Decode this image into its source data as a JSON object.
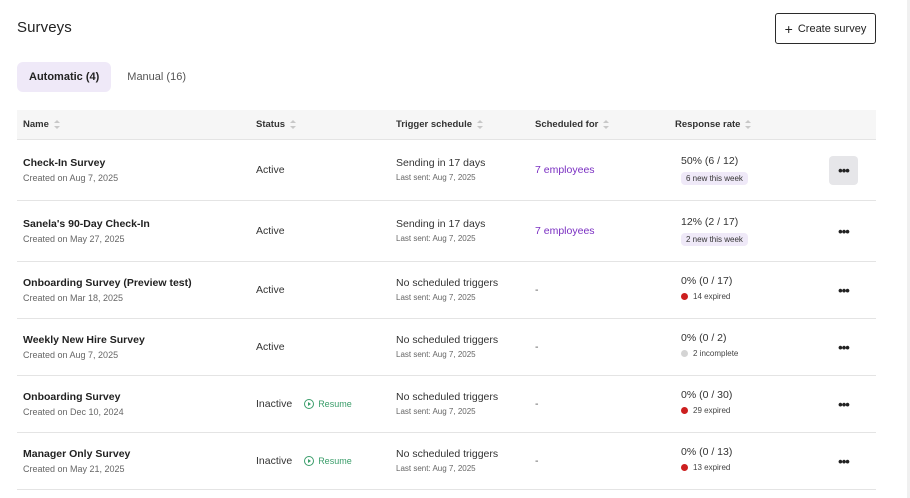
{
  "page": {
    "title": "Surveys",
    "create_label": "Create survey"
  },
  "tabs": [
    {
      "label": "Automatic (4)",
      "active": true
    },
    {
      "label": "Manual (16)",
      "active": false
    }
  ],
  "columns": [
    "Name",
    "Status",
    "Trigger schedule",
    "Scheduled for",
    "Response rate"
  ],
  "colors": {
    "accent": "#7a2fc2",
    "pill_bg": "#efe9f8",
    "expired": "#cc1f1f",
    "incomplete": "#d4d4d4",
    "resume": "#3a9d6a"
  },
  "rows": [
    {
      "name": "Check-In Survey",
      "created": "Created on Aug 7, 2025",
      "status": "Active",
      "resume": "",
      "trigger": "Sending in 17 days",
      "last_sent": "Last sent: Aug 7, 2025",
      "scheduled": "7 employees",
      "rate": "50% (6 / 12)",
      "pill": "6 new this week",
      "meta": "",
      "meta_color": "",
      "more": "•••"
    },
    {
      "name": "Sanela's 90-Day Check-In",
      "created": "Created on May 27, 2025",
      "status": "Active",
      "resume": "",
      "trigger": "Sending in 17 days",
      "last_sent": "Last sent: Aug 7, 2025",
      "scheduled": "7 employees",
      "rate": "12% (2 / 17)",
      "pill": "2 new this week",
      "meta": "",
      "meta_color": "",
      "more": "•••"
    },
    {
      "name": "Onboarding Survey (Preview test)",
      "created": "Created on Mar 18, 2025",
      "status": "Active",
      "resume": "",
      "trigger": "No scheduled triggers",
      "last_sent": "Last sent: Aug 7, 2025",
      "scheduled": "-",
      "rate": "0% (0 / 17)",
      "pill": "",
      "meta": "14 expired",
      "meta_color": "#cc1f1f",
      "more": "•••"
    },
    {
      "name": "Weekly New Hire Survey",
      "created": "Created on Aug 7, 2025",
      "status": "Active",
      "resume": "",
      "trigger": "No scheduled triggers",
      "last_sent": "Last sent: Aug 7, 2025",
      "scheduled": "-",
      "rate": "0% (0 / 2)",
      "pill": "",
      "meta": "2 incomplete",
      "meta_color": "#d4d4d4",
      "more": "•••"
    },
    {
      "name": "Onboarding Survey",
      "created": "Created on Dec 10, 2024",
      "status": "Inactive",
      "resume": "Resume",
      "trigger": "No scheduled triggers",
      "last_sent": "Last sent: Aug 7, 2025",
      "scheduled": "-",
      "rate": "0% (0 / 30)",
      "pill": "",
      "meta": "29 expired",
      "meta_color": "#cc1f1f",
      "more": "•••"
    },
    {
      "name": "Manager Only Survey",
      "created": "Created on May 21, 2025",
      "status": "Inactive",
      "resume": "Resume",
      "trigger": "No scheduled triggers",
      "last_sent": "Last sent: Aug 7, 2025",
      "scheduled": "-",
      "rate": "0% (0 / 13)",
      "pill": "",
      "meta": "13 expired",
      "meta_color": "#cc1f1f",
      "more": "•••"
    }
  ]
}
